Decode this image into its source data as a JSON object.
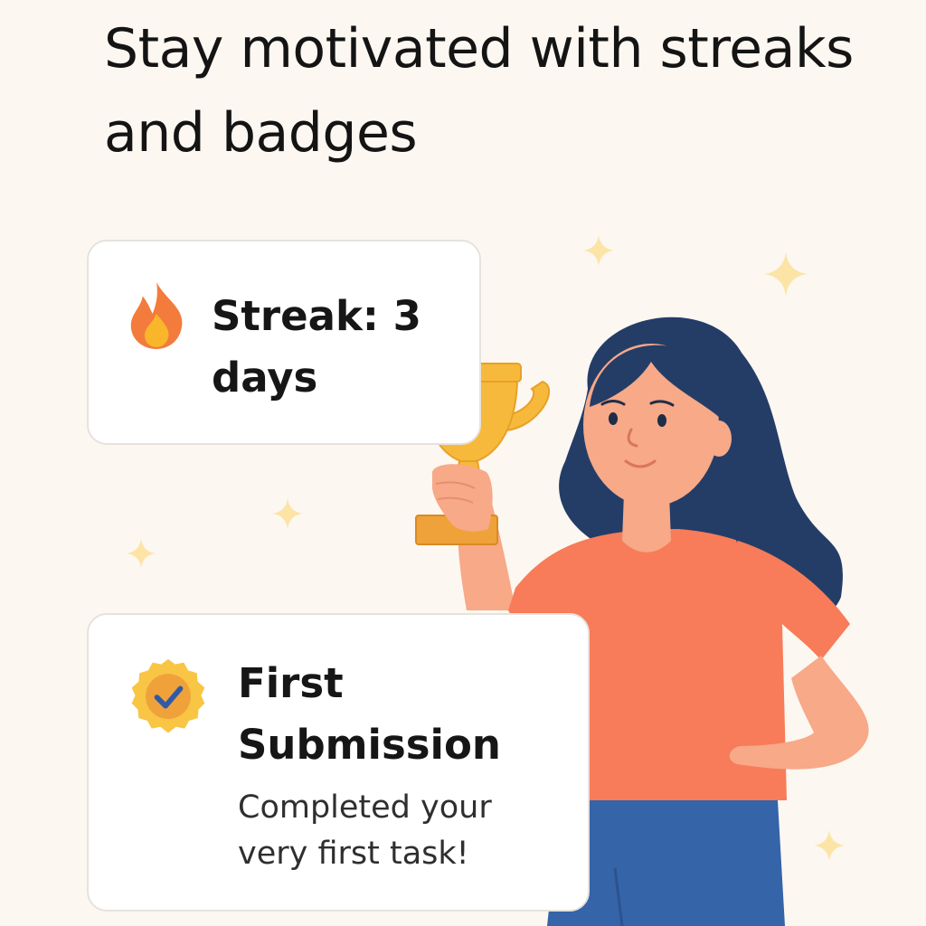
{
  "headline": "Stay motivated with streaks and badges",
  "streak_card": {
    "icon": "flame-icon",
    "label": "Streak: 3 days"
  },
  "badge_card": {
    "icon": "check-badge-icon",
    "title": "First Submission",
    "description": "Completed your very first task!"
  },
  "illustration": {
    "subject": "woman-holding-trophy",
    "icons": [
      "trophy-icon",
      "sparkle-icon"
    ]
  },
  "colors": {
    "background": "#fdf7f1",
    "shirt": "#f87c59",
    "hair": "#243d67",
    "pants": "#3564a8",
    "trophy": "#f6b93b",
    "skin": "#f7a988",
    "sparkle": "#fbe4a6",
    "badge_gold": "#f8c544",
    "check": "#2f5aa8",
    "flame_outer": "#f37b3c",
    "flame_inner": "#f9b62a"
  }
}
